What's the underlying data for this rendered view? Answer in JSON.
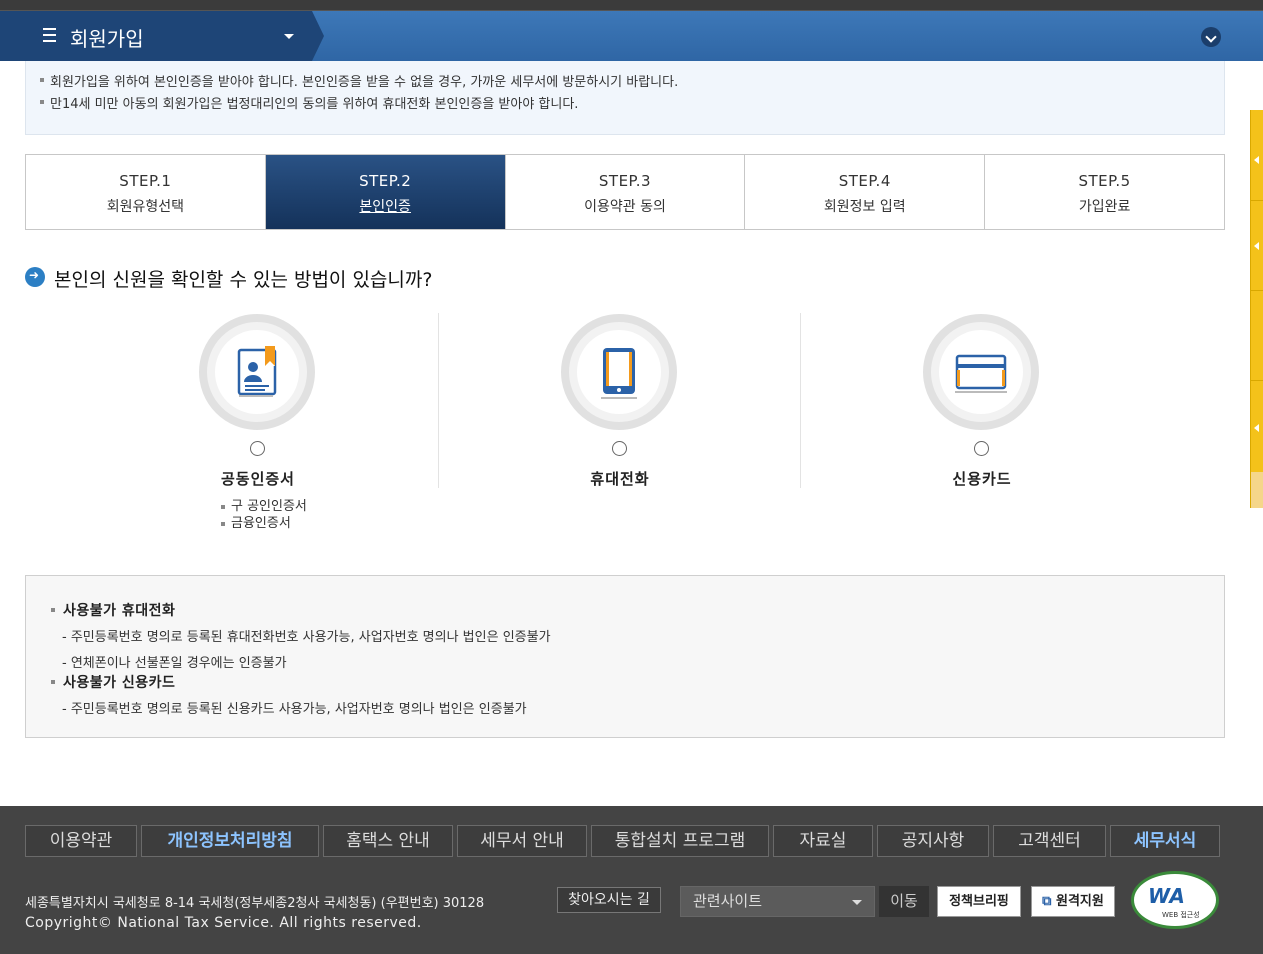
{
  "header": {
    "title": "회원가입"
  },
  "notice": {
    "lines": [
      "회원가입을 위하여 본인인증을 받아야 합니다. 본인인증을 받을 수 없을 경우, 가까운 세무서에 방문하시기 바랍니다.",
      "만14세 미만 아동의 회원가입은 법정대리인의 동의를 위하여 휴대전화 본인인증을 받아야 합니다."
    ]
  },
  "steps": [
    {
      "num": "STEP.1",
      "label": "회원유형선택",
      "active": false
    },
    {
      "num": "STEP.2",
      "label": "본인인증",
      "active": true
    },
    {
      "num": "STEP.3",
      "label": "이용약관 동의",
      "active": false
    },
    {
      "num": "STEP.4",
      "label": "회원정보 입력",
      "active": false
    },
    {
      "num": "STEP.5",
      "label": "가입완료",
      "active": false
    }
  ],
  "question": "본인의 신원을 확인할 수 있는 방법이 있습니까?",
  "methods": [
    {
      "label": "공동인증서",
      "icon": "certificate-icon"
    },
    {
      "label": "휴대전화",
      "icon": "mobile-phone-icon"
    },
    {
      "label": "신용카드",
      "icon": "credit-card-icon"
    }
  ],
  "cert_notes": [
    "구 공인인증서",
    "금융인증서"
  ],
  "info": {
    "phone_title": "사용불가 휴대전화",
    "phone_notes": [
      "- 주민등록번호 명의로 등록된 휴대전화번호 사용가능, 사업자번호 명의나 법인은 인증불가",
      "- 연체폰이나 선불폰일 경우에는 인증불가"
    ],
    "card_title": "사용불가 신용카드",
    "card_notes": [
      "- 주민등록번호 명의로 등록된 신용카드 사용가능, 사업자번호 명의나 법인은 인증불가"
    ]
  },
  "footer": {
    "nav": [
      "이용약관",
      "개인정보처리방침",
      "홈택스 안내",
      "세무서 안내",
      "통합설치 프로그램",
      "자료실",
      "공지사항",
      "고객센터",
      "세무서식"
    ],
    "address": "세종특별자치시 국세청로 8-14 국세청(정부세종2청사 국세청동) (우편번호) 30128",
    "find_button": "찾아오시는 길",
    "copyright": "Copyright© National Tax Service. All rights reserved.",
    "related_select": "관련사이트",
    "go_button": "이동",
    "policy_badge": "정책브리핑",
    "remote_badge": "원격지원",
    "wa_mark": "WA",
    "wa_sub": "WEB 접근성"
  },
  "colors": {
    "header_blue": "#2f66a5",
    "step_active": "#1e4577",
    "footer_bg": "#444444",
    "side_tab": "#f4c21a"
  }
}
